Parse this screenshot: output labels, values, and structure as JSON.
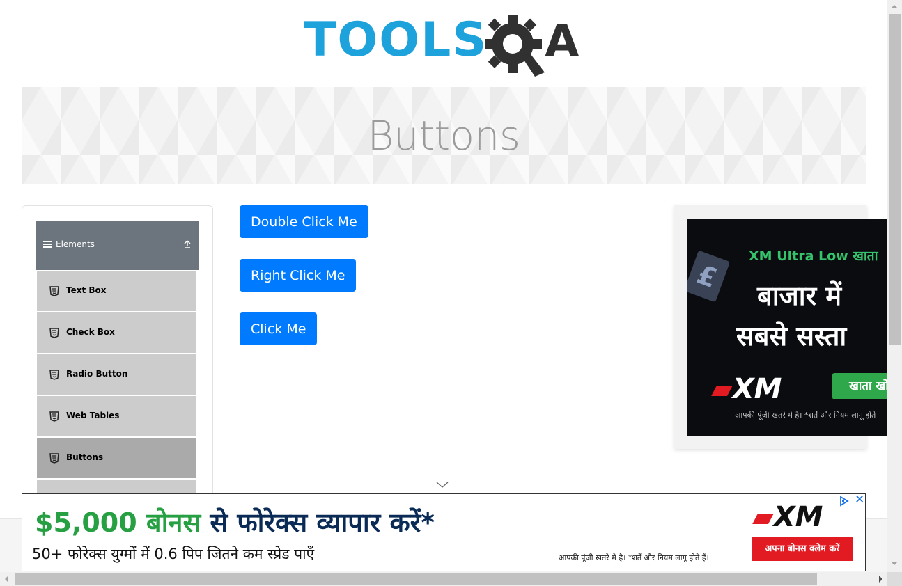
{
  "logo": {
    "text": "TOOLS",
    "suffix": "A",
    "brand_color": "#1ea2dc"
  },
  "banner": {
    "title": "Buttons"
  },
  "sidebar": {
    "group_title": "Elements",
    "items": [
      {
        "label": "Text Box"
      },
      {
        "label": "Check Box"
      },
      {
        "label": "Radio Button"
      },
      {
        "label": "Web Tables"
      },
      {
        "label": "Buttons",
        "active": true
      },
      {
        "label": ""
      }
    ]
  },
  "buttons": {
    "double_click": "Double Click Me",
    "right_click": "Right Click Me",
    "click": "Click Me",
    "color": "#007bff"
  },
  "ad_right": {
    "line1": "XM Ultra Low खाता",
    "line2": "बाजार में",
    "line3": "सबसे सस्ता",
    "brand": "XM",
    "cta": "खाता खो",
    "disclaimer": "आपकी पूंजी खतरे मे है। *शर्तें और नियम लागू होते"
  },
  "ad_bottom": {
    "headline_amount": "$5,000 बोनस",
    "headline_rest": " से फोरेक्स व्यापार करें*",
    "subline": "50+ फोरेक्स युग्मों में 0.6 पिप जितने कम स्प्रेड पाएँ",
    "disclaimer": "आपकी पूंजी खतरे मे है। *शर्तें और नियम लागू होते हैं।",
    "brand": "XM",
    "cta": "अपना बोनस क्लेम करें"
  }
}
